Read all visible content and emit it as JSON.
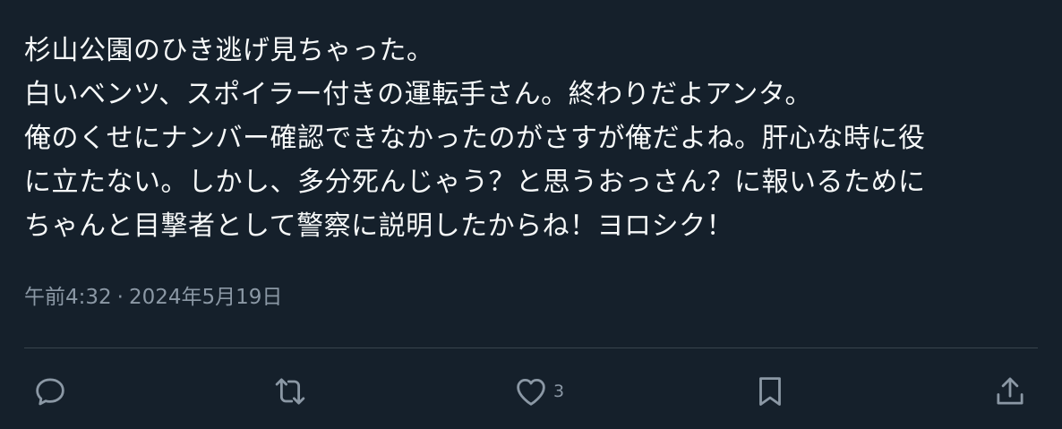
{
  "tweet": {
    "lines": [
      "杉山公園のひき逃げ見ちゃった。",
      "白いベンツ、スポイラー付きの運転手さん。終わりだよアンタ。",
      "俺のくせにナンバー確認できなかったのがさすが俺だよね。肝心な時に役",
      "に立たない。しかし、多分死んじゃう？と思うおっさん？に報いるために",
      "ちゃんと目撃者として警察に説明したからね！ヨロシク！"
    ],
    "time": "午前4:32",
    "separator": "·",
    "date": "2024年5月19日"
  },
  "actions": {
    "reply": {
      "icon": "reply-icon"
    },
    "retweet": {
      "icon": "retweet-icon"
    },
    "like": {
      "icon": "heart-icon",
      "count": "3"
    },
    "bookmark": {
      "icon": "bookmark-icon"
    },
    "share": {
      "icon": "share-icon"
    }
  },
  "colors": {
    "background": "#15202b",
    "text": "#f7f9f9",
    "muted": "#8b98a5",
    "divider": "#38444d"
  }
}
